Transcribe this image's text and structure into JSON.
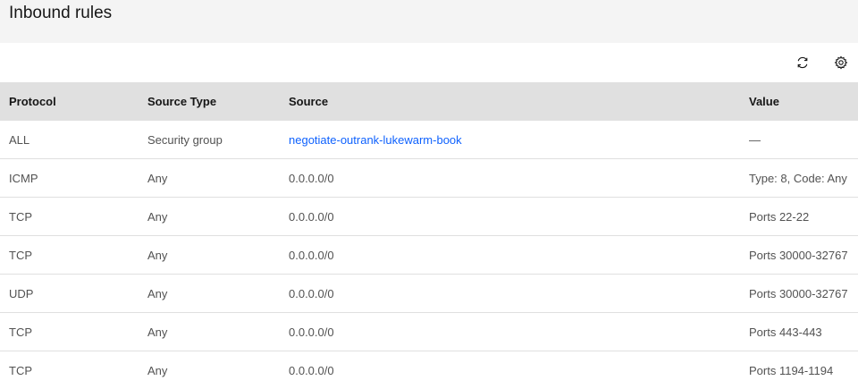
{
  "header": {
    "title": "Inbound rules"
  },
  "toolbar": {
    "refresh_icon": "refresh-icon",
    "settings_icon": "gear-icon"
  },
  "table": {
    "columns": [
      "Protocol",
      "Source Type",
      "Source",
      "Value"
    ],
    "rows": [
      {
        "protocol": "ALL",
        "source_type": "Security group",
        "source": "negotiate-outrank-lukewarm-book",
        "value": "—",
        "source_is_link": true
      },
      {
        "protocol": "ICMP",
        "source_type": "Any",
        "source": "0.0.0.0/0",
        "value": "Type: 8, Code: Any",
        "source_is_link": false
      },
      {
        "protocol": "TCP",
        "source_type": "Any",
        "source": "0.0.0.0/0",
        "value": "Ports 22-22",
        "source_is_link": false
      },
      {
        "protocol": "TCP",
        "source_type": "Any",
        "source": "0.0.0.0/0",
        "value": "Ports 30000-32767",
        "source_is_link": false
      },
      {
        "protocol": "UDP",
        "source_type": "Any",
        "source": "0.0.0.0/0",
        "value": "Ports 30000-32767",
        "source_is_link": false
      },
      {
        "protocol": "TCP",
        "source_type": "Any",
        "source": "0.0.0.0/0",
        "value": "Ports 443-443",
        "source_is_link": false
      },
      {
        "protocol": "TCP",
        "source_type": "Any",
        "source": "0.0.0.0/0",
        "value": "Ports 1194-1194",
        "source_is_link": false
      }
    ]
  },
  "colors": {
    "link": "#0f62fe",
    "header_bg": "#e0e0e0",
    "page_bg": "#f4f4f4"
  }
}
